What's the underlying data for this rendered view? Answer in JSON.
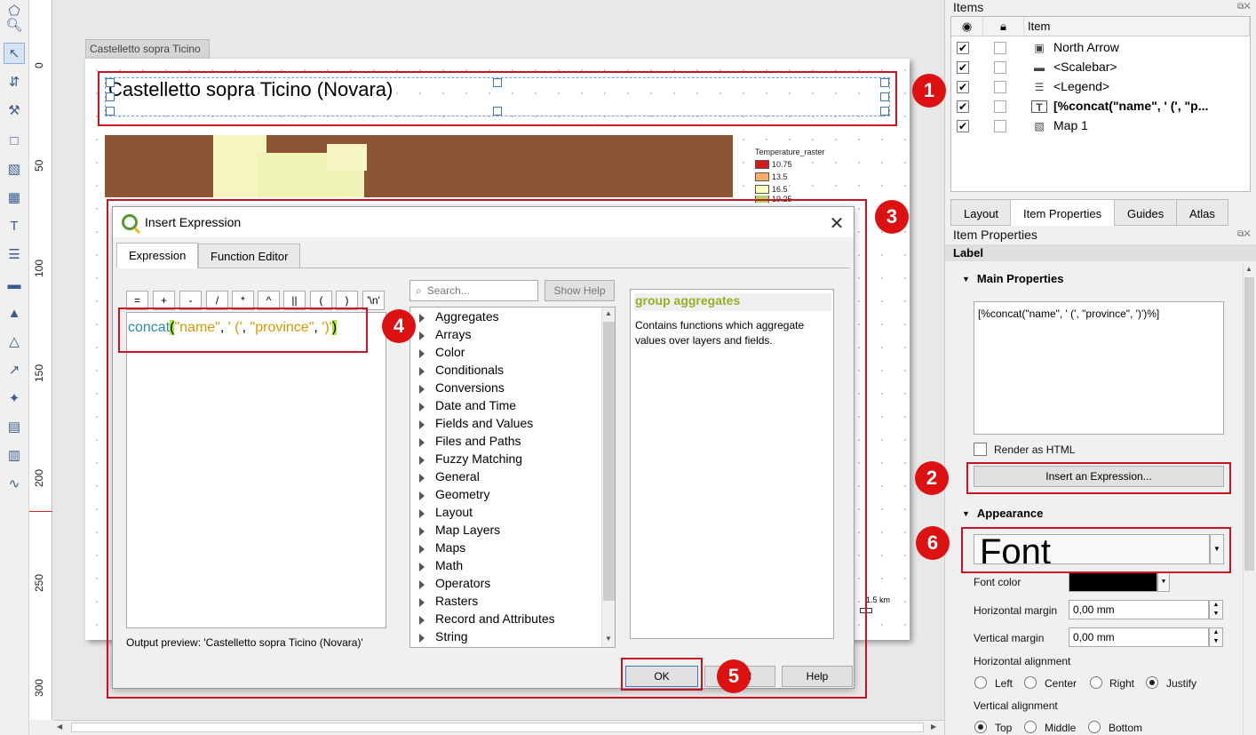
{
  "layout_page": {
    "tab_label": "Castelletto sopra Ticino",
    "title_text": "Castelletto sopra Ticino (Novara)",
    "legend": {
      "title": "Temperature_raster",
      "entries": [
        {
          "label": "10.75",
          "color": "#d7191c"
        },
        {
          "label": "13.5",
          "color": "#fdae61"
        },
        {
          "label": "16.5",
          "color": "#ffffbf"
        },
        {
          "label": "19.25",
          "color": "#a6d96a"
        }
      ]
    },
    "scale_label": "1.5 km"
  },
  "ruler": {
    "ticks": [
      "0",
      "50",
      "100",
      "150",
      "200",
      "250",
      "300"
    ]
  },
  "callouts": [
    "1",
    "2",
    "3",
    "4",
    "5",
    "6"
  ],
  "dialog": {
    "title": "Insert Expression",
    "tabs": [
      "Expression",
      "Function Editor"
    ],
    "operators": [
      "=",
      "+",
      "-",
      "/",
      "*",
      "^",
      "||",
      "(",
      ")",
      "'\\n'"
    ],
    "expression": {
      "fn": "concat",
      "open": "(",
      "arg1": "\"name\"",
      "sep1": ", ",
      "arg2": "' ('",
      "sep2": ", ",
      "arg3": "\"province\"",
      "sep3": ", ",
      "arg4": "')'",
      "close": ")"
    },
    "output_preview": "Output preview:  'Castelletto sopra Ticino (Novara)'",
    "search_placeholder": "Search...",
    "show_help_label": "Show Help",
    "function_groups": [
      "Aggregates",
      "Arrays",
      "Color",
      "Conditionals",
      "Conversions",
      "Date and Time",
      "Fields and Values",
      "Files and Paths",
      "Fuzzy Matching",
      "General",
      "Geometry",
      "Layout",
      "Map Layers",
      "Maps",
      "Math",
      "Operators",
      "Rasters",
      "Record and Attributes",
      "String"
    ],
    "help": {
      "heading": "group aggregates",
      "body": "Contains functions which aggregate values over layers and fields."
    },
    "ok_label": "OK",
    "cancel_label": "el",
    "help_label": "Help"
  },
  "items_panel": {
    "title": "Items",
    "column_header": "Item",
    "items": [
      {
        "label": "North Arrow",
        "icon": "picture-icon",
        "visible": true,
        "bold": false
      },
      {
        "label": "<Scalebar>",
        "icon": "scalebar-icon",
        "visible": true,
        "bold": false
      },
      {
        "label": "<Legend>",
        "icon": "legend-icon",
        "visible": true,
        "bold": false
      },
      {
        "label": "[%concat(\"name\", ' (', \"p...",
        "icon": "label-icon",
        "visible": true,
        "bold": true
      },
      {
        "label": "Map 1",
        "icon": "map-icon",
        "visible": true,
        "bold": false
      }
    ]
  },
  "right_tabs": [
    "Layout",
    "Item Properties",
    "Guides",
    "Atlas"
  ],
  "item_properties": {
    "title": "Item Properties",
    "item_type": "Label",
    "main_section": "Main Properties",
    "label_text": "[%concat(\"name\", ' (', \"province\", ')')%]",
    "render_html_label": "Render as HTML",
    "insert_expr_label": "Insert an Expression...",
    "appearance_section": "Appearance",
    "font_button_label": "Font",
    "font_color_label": "Font color",
    "font_color": "#000000",
    "hmargin_label": "Horizontal margin",
    "hmargin_value": "0,00 mm",
    "vmargin_label": "Vertical margin",
    "vmargin_value": "0,00 mm",
    "halign_label": "Horizontal alignment",
    "halign_options": [
      "Left",
      "Center",
      "Right",
      "Justify"
    ],
    "halign_selected": "Justify",
    "valign_label": "Vertical alignment",
    "valign_options": [
      "Top",
      "Middle",
      "Bottom"
    ],
    "valign_selected": "Top"
  }
}
